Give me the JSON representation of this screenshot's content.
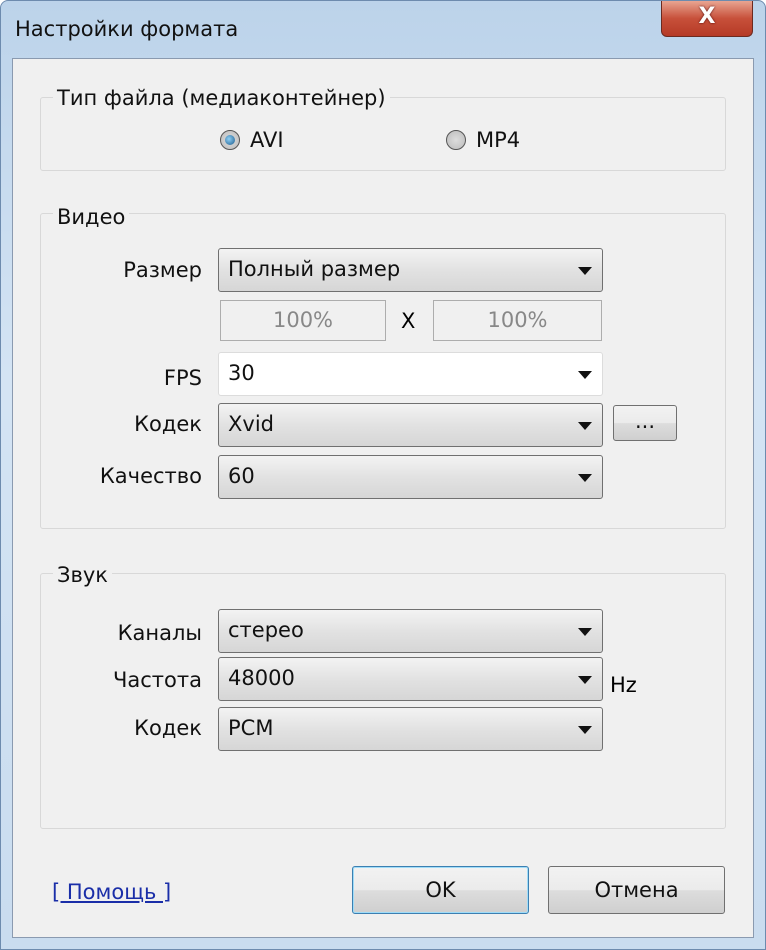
{
  "window": {
    "title": "Настройки формата",
    "close_label": "X"
  },
  "file_type": {
    "legend": "Тип файла (медиаконтейнер)",
    "options": [
      {
        "label": "AVI",
        "selected": true
      },
      {
        "label": "MP4",
        "selected": false
      }
    ]
  },
  "video": {
    "legend": "Видео",
    "size": {
      "label": "Размер",
      "value": "Полный размер",
      "width": "100%",
      "separator": "X",
      "height": "100%"
    },
    "fps": {
      "label": "FPS",
      "value": "30"
    },
    "codec": {
      "label": "Кодек",
      "value": "Xvid",
      "settings_button": "..."
    },
    "quality": {
      "label": "Качество",
      "value": "60"
    }
  },
  "audio": {
    "legend": "Звук",
    "channels": {
      "label": "Каналы",
      "value": "стерео"
    },
    "frequency": {
      "label": "Частота",
      "value": "48000",
      "unit": "Hz"
    },
    "codec": {
      "label": "Кодек",
      "value": "PCM"
    }
  },
  "footer": {
    "help_link": "[ Помощь ]",
    "ok": "OK",
    "cancel": "Отмена"
  }
}
